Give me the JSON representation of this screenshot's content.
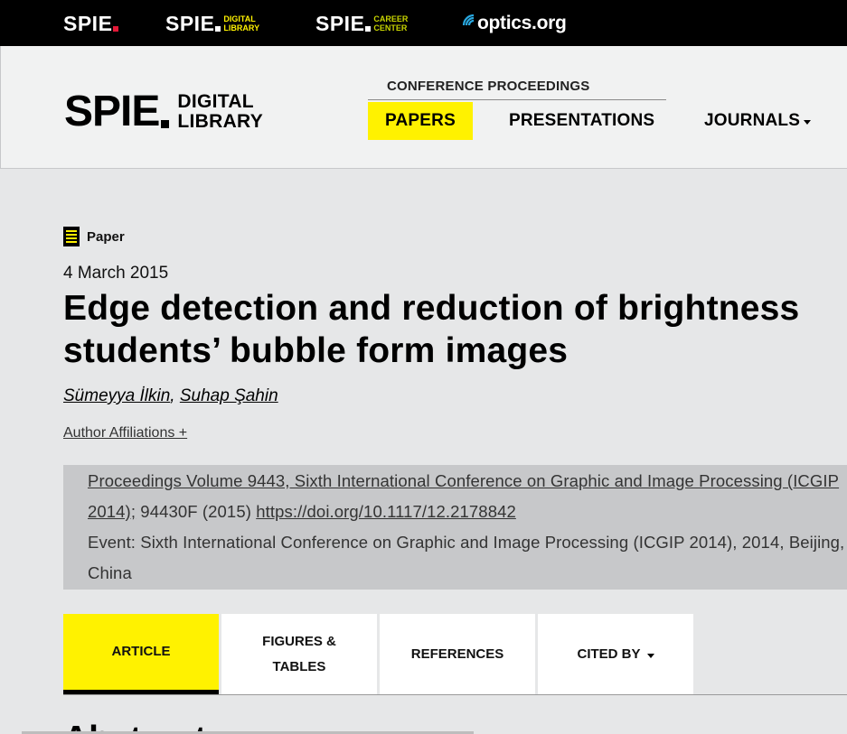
{
  "topbar": {
    "brands": [
      {
        "name": "SPIE",
        "sub": "",
        "dot_color": "#e31937"
      },
      {
        "name": "SPIE",
        "sub_line1": "DIGITAL",
        "sub_line2": "LIBRARY",
        "dot_color": "#fff200",
        "sub_color": "#fff200"
      },
      {
        "name": "SPIE",
        "sub_line1": "CAREER",
        "sub_line2": "CENTER",
        "dot_color": "#c8d400",
        "sub_color": "#c8d400"
      }
    ],
    "optics": {
      "text": "optics.org",
      "icon": "optics-arc-icon",
      "color": "#29a8e0"
    }
  },
  "header": {
    "logo": {
      "name": "SPIE",
      "sub_line1": "DIGITAL",
      "sub_line2": "LIBRARY"
    },
    "section_label": "CONFERENCE PROCEEDINGS",
    "nav": {
      "papers": "PAPERS",
      "presentations": "PRESENTATIONS",
      "journals": "JOURNALS"
    },
    "active_color": "#fff200"
  },
  "paper": {
    "badge_label": "Paper",
    "badge_icon": "paper-document-icon",
    "date": "4 March 2015",
    "title_line1": "Edge detection and reduction of brightness",
    "title_line2": "students’ bubble form images",
    "authors": [
      "Sümeyya İlkin",
      "Suhap Şahin"
    ],
    "author_separator": ",",
    "affiliations_label": "Author Affiliations +"
  },
  "proceedings": {
    "volume_link_part1": "Proceedings Volume 9443, Sixth International Conference on Graphic and Image Processing (ICGIP",
    "volume_link_part2": "2014);",
    "article_id": " 94430F (2015) ",
    "doi": "https://doi.org/10.1117/12.2178842",
    "event_line1": "Event: Sixth International Conference on Graphic and Image Processing (ICGIP 2014), 2014, Beijing,",
    "event_line2": "China"
  },
  "tabs": {
    "article": "ARTICLE",
    "figures_line1": "FIGURES &",
    "figures_line2": "TABLES",
    "references": "REFERENCES",
    "cited_by": "CITED BY"
  },
  "abstract_heading": "Abstract"
}
